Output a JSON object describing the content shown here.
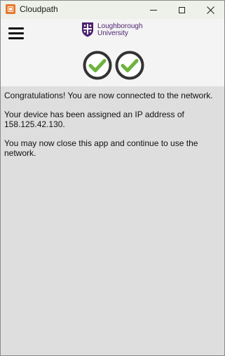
{
  "window": {
    "title": "Cloudpath",
    "app_icon": "cloudpath-app-icon",
    "controls": {
      "minimize_icon": "minimize-icon",
      "maximize_icon": "maximize-icon",
      "close_icon": "close-icon",
      "close_glyph": "✕"
    }
  },
  "header": {
    "menu_icon": "hamburger-menu-icon",
    "logo": {
      "line1": "Loughborough",
      "line2": "University",
      "color": "#4b1f6f"
    },
    "status_icons": [
      "check-circle-icon",
      "check-circle-icon"
    ],
    "check_color": "#6db33f"
  },
  "content": {
    "line1": "Congratulations! You are now connected to the network.",
    "line2": "Your device has been assigned an IP address of 158.125.42.130.",
    "line3": "You may now close this app and continue to use the network."
  }
}
